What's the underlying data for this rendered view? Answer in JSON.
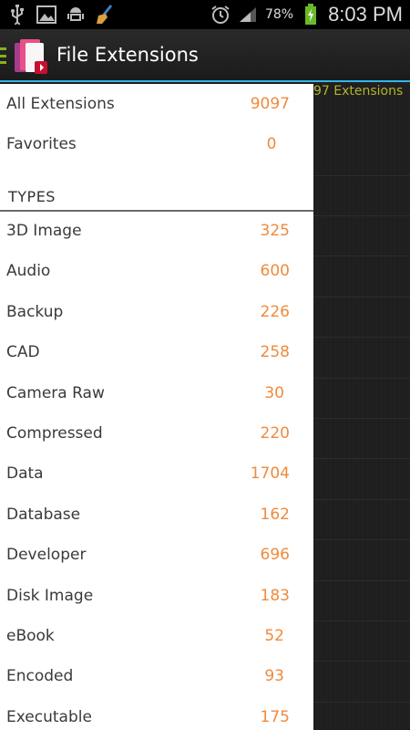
{
  "status_bar": {
    "left_icons": [
      "usb-icon",
      "image-icon",
      "android-debug-icon",
      "broom-icon"
    ],
    "battery_percent": "78%",
    "time": "8:03 PM"
  },
  "action_bar": {
    "title": "File Extensions"
  },
  "background": {
    "header_text": "97 Extensions"
  },
  "drawer": {
    "top_items": [
      {
        "label": "All Extensions",
        "count": "9097"
      },
      {
        "label": "Favorites",
        "count": "0"
      }
    ],
    "section_title": "TYPES",
    "types": [
      {
        "label": "3D Image",
        "count": "325"
      },
      {
        "label": "Audio",
        "count": "600"
      },
      {
        "label": "Backup",
        "count": "226"
      },
      {
        "label": "CAD",
        "count": "258"
      },
      {
        "label": "Camera Raw",
        "count": "30"
      },
      {
        "label": "Compressed",
        "count": "220"
      },
      {
        "label": "Data",
        "count": "1704"
      },
      {
        "label": "Database",
        "count": "162"
      },
      {
        "label": "Developer",
        "count": "696"
      },
      {
        "label": "Disk Image",
        "count": "183"
      },
      {
        "label": "eBook",
        "count": "52"
      },
      {
        "label": "Encoded",
        "count": "93"
      },
      {
        "label": "Executable",
        "count": "175"
      }
    ]
  },
  "colors": {
    "accent": "#33b5e5",
    "count": "#f08a3c",
    "drawer_indicator": "#86b21c"
  }
}
